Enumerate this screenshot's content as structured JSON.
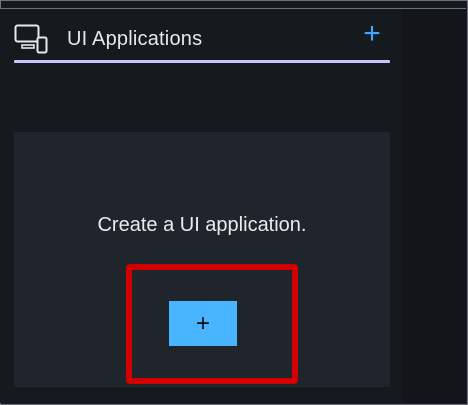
{
  "header": {
    "title": "UI Applications",
    "icon": "devices-icon",
    "add_icon": "plus-icon",
    "add_label": "+"
  },
  "empty_state": {
    "message": "Create a UI application.",
    "button_label": "+"
  },
  "colors": {
    "accent_blue": "#3ea6ff",
    "button_blue": "#49b4ff",
    "underline_lavender": "#c9c3ff",
    "highlight_red": "#d40000",
    "card_background": "#20252c",
    "panel_background": "#151a1f"
  }
}
